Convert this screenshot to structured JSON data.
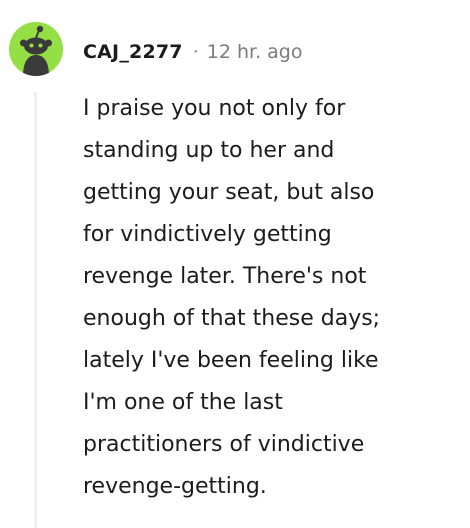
{
  "comment": {
    "avatar_icon": "snoo-avatar-icon",
    "avatar_color": "#94e044",
    "username": "CAJ_2277",
    "separator": "·",
    "timestamp": "12 hr. ago",
    "body_lines": [
      "I praise you not only for",
      "standing up to her and",
      "getting your seat, but also",
      "for vindictively getting",
      "revenge later. There's not",
      "enough of that these days;",
      "lately I've been feeling like",
      "I'm one of the last",
      "practitioners of vindictive",
      "revenge-getting."
    ]
  }
}
